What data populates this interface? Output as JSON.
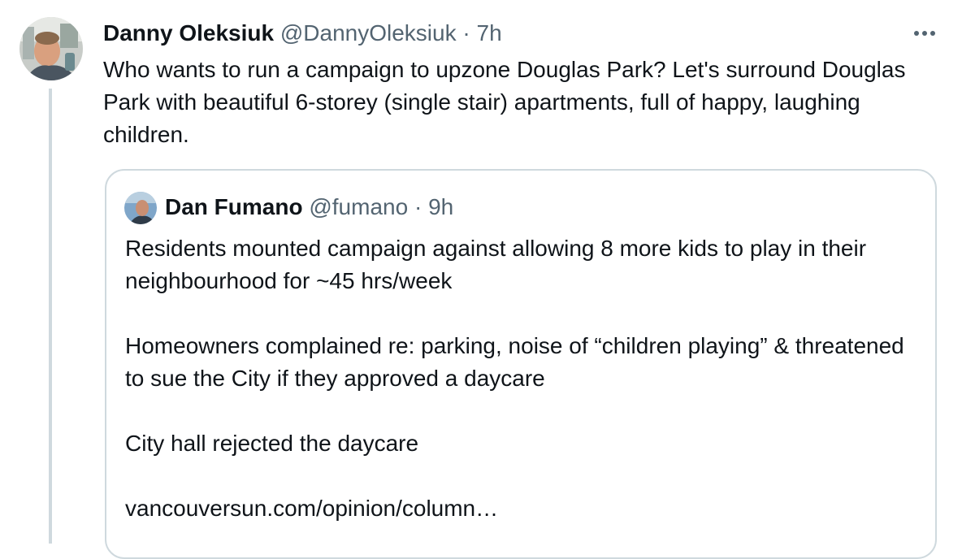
{
  "tweet": {
    "author_name": "Danny Oleksiuk",
    "author_handle": "@DannyOleksiuk",
    "separator": "·",
    "time": "7h",
    "more_icon": "more-horizontal-icon",
    "text": "Who wants to run a campaign to upzone Douglas Park? Let's surround Douglas Park with beautiful 6-storey (single stair) apartments, full of happy, laughing children."
  },
  "quote": {
    "author_name": "Dan Fumano",
    "author_handle": "@fumano",
    "separator": "·",
    "time": "9h",
    "paragraphs": [
      "Residents mounted campaign against allowing 8 more kids to play in their neighbourhood for ~45 hrs/week",
      "Homeowners complained re: parking, noise of “children playing” & threatened to sue the City if they approved a daycare",
      "City hall rejected the daycare",
      "vancouversun.com/opinion/column…"
    ]
  },
  "colors": {
    "text": "#0f1419",
    "secondary": "#536471",
    "border": "#cfd9de"
  }
}
